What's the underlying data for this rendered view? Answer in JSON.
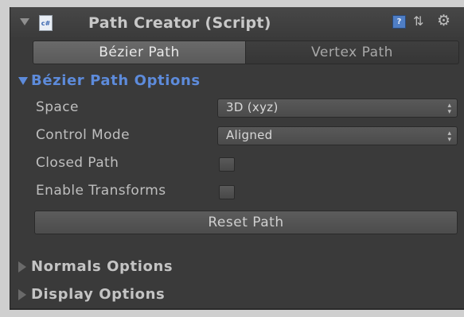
{
  "header": {
    "title": "Path Creator (Script)",
    "script_icon_text": "c#",
    "help_icon_text": "?",
    "icons": [
      "fold-arrow-icon",
      "script-icon",
      "help-icon",
      "preset-icon",
      "gear-icon"
    ]
  },
  "tabs": [
    {
      "label": "Bézier Path",
      "active": true
    },
    {
      "label": "Vertex Path",
      "active": false
    }
  ],
  "bezier_options": {
    "title": "Bézier Path Options",
    "expanded": true,
    "space": {
      "label": "Space",
      "value": "3D (xyz)"
    },
    "control_mode": {
      "label": "Control Mode",
      "value": "Aligned"
    },
    "closed_path": {
      "label": "Closed Path",
      "checked": false
    },
    "enable_transforms": {
      "label": "Enable Transforms",
      "checked": false
    },
    "reset_button": "Reset Path"
  },
  "normals_options": {
    "title": "Normals Options",
    "expanded": false
  },
  "display_options": {
    "title": "Display Options",
    "expanded": false
  },
  "colors": {
    "accent": "#5d8bdb",
    "panel_bg": "#3a3a3a",
    "text": "#bfbfbf"
  }
}
